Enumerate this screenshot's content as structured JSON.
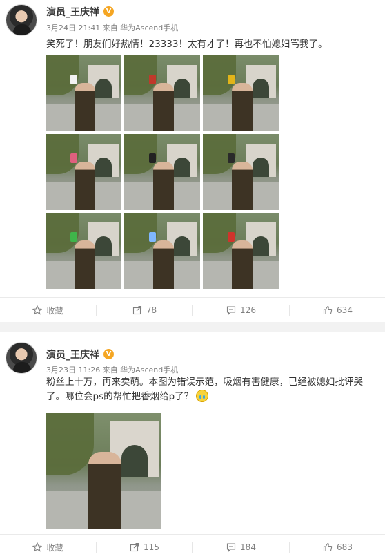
{
  "posts": [
    {
      "author": "演员_王庆祥",
      "verified_badge": "V",
      "meta": "3月24日 21:41 来自 华为Ascend手机",
      "text": "笑死了！朋友们好热情！23333！太有才了！再也不怕媳妇骂我了。",
      "images": [
        {
          "prop_color": "#f2f2f2"
        },
        {
          "prop_color": "#c0392b"
        },
        {
          "prop_color": "#e2b419"
        },
        {
          "prop_color": "#e0607e"
        },
        {
          "prop_color": "#222222"
        },
        {
          "prop_color": "#2a2a2a"
        },
        {
          "prop_color": "#3fb54a"
        },
        {
          "prop_color": "#7fb7ff"
        },
        {
          "prop_color": "#d0342c"
        }
      ],
      "actions": {
        "favorite": "收藏",
        "repost": "78",
        "comment": "126",
        "like": "634"
      }
    },
    {
      "author": "演员_王庆祥",
      "verified_badge": "V",
      "meta": "3月23日 11:26 来自 华为Ascend手机",
      "text": "粉丝上十万，再来卖萌。本图为错误示范，吸烟有害健康，已经被媳妇批评哭了。哪位会ps的帮忙把香烟给p了？",
      "emoji": "crying-face",
      "actions": {
        "favorite": "收藏",
        "repost": "115",
        "comment": "184",
        "like": "683"
      }
    }
  ],
  "colors": {
    "verified": "#f5a623",
    "meta": "#808080",
    "text": "#333333"
  }
}
